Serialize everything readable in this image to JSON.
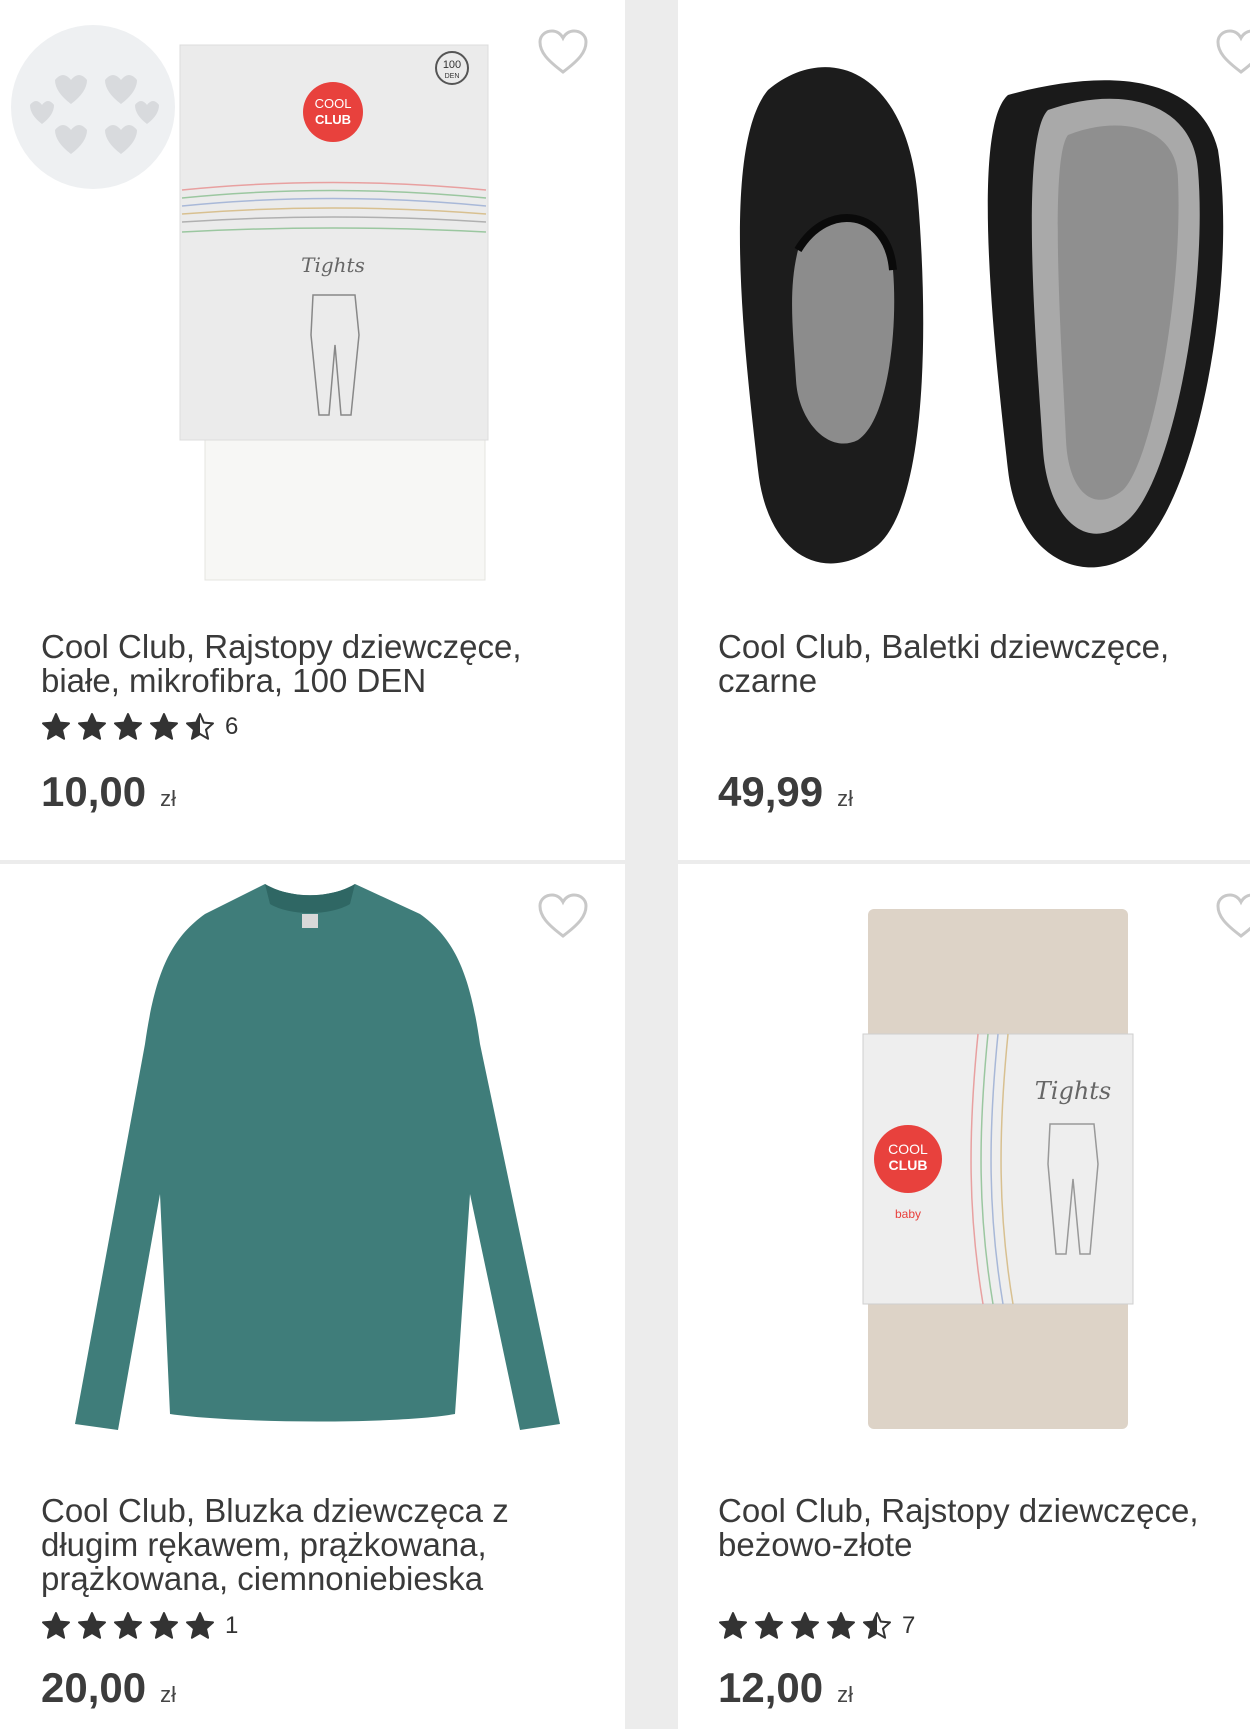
{
  "products": [
    {
      "title": "Cool Club, Rajstopy dziewczęce,\nbiałe, mikrofibra, 100 DEN",
      "rating_stars": 4.5,
      "rating_count": "6",
      "price": "10,00",
      "currency": "zł",
      "image_icon": "tights-white-package",
      "package_text": {
        "brand_line1": "COOL",
        "brand_line2": "CLUB",
        "label": "Tights",
        "den": "100",
        "den_unit": "DEN"
      }
    },
    {
      "title": "Cool Club, Baletki dziewczęce,\nczarne",
      "rating_stars": null,
      "rating_count": "",
      "price": "49,99",
      "currency": "zł",
      "image_icon": "black-ballet-flats"
    },
    {
      "title": "Cool Club, Bluzka dziewczęca z\ndługim rękawem, prążkowana,\nprążkowana, ciemnoniebieska",
      "rating_stars": 5,
      "rating_count": "1",
      "price": "20,00",
      "currency": "zł",
      "image_icon": "teal-longsleeve-shirt"
    },
    {
      "title": "Cool Club, Rajstopy dziewczęce,\nbeżowo-złote",
      "rating_stars": 4.5,
      "rating_count": "7",
      "price": "12,00",
      "currency": "zł",
      "image_icon": "beige-tights-package",
      "package_text": {
        "brand_line1": "COOL",
        "brand_line2": "CLUB",
        "sub": "baby",
        "label": "Tights"
      }
    }
  ],
  "colors": {
    "brand_red": "#e8413d",
    "shirt": "#3f7d7a",
    "star": "#333333",
    "heart": "#c8c8c8"
  }
}
